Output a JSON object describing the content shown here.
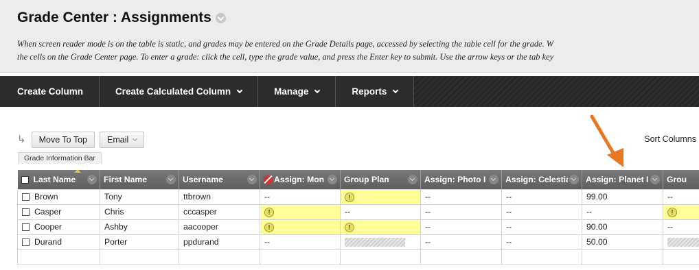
{
  "page": {
    "title": "Grade Center : Assignments",
    "instructions_line1": "When screen reader mode is on the table is static, and grades may be entered on the Grade Details page, accessed by selecting the table cell for the grade. W",
    "instructions_line2": "the cells on the Grade Center page. To enter a grade: click the cell, type the grade value, and press the Enter key to submit. Use the arrow keys or the tab key"
  },
  "toolbar": {
    "create_column": "Create Column",
    "create_calculated_column": "Create Calculated Column",
    "manage": "Manage",
    "reports": "Reports"
  },
  "actions": {
    "move_to_top": "Move To Top",
    "email": "Email",
    "sort_columns": "Sort Columns",
    "grade_info_bar": "Grade Information Bar"
  },
  "grid": {
    "headers": [
      "Last Name",
      "First Name",
      "Username",
      "Assign: Mon",
      "Group Plan",
      "Assign: Photo I",
      "Assign: Celestia",
      "Assign: Planet I",
      "Grou"
    ],
    "rows": [
      {
        "last": "Brown",
        "first": "Tony",
        "user": "ttbrown",
        "c4": "--",
        "c5": "needs",
        "c6": "--",
        "c7": "--",
        "c8": "99.00",
        "c9": "--"
      },
      {
        "last": "Casper",
        "first": "Chris",
        "user": "cccasper",
        "c4": "needs",
        "c5": "--",
        "c6": "--",
        "c7": "--",
        "c8": "--",
        "c9": "needs"
      },
      {
        "last": "Cooper",
        "first": "Ashby",
        "user": "aacooper",
        "c4": "needs",
        "c5": "needs",
        "c6": "--",
        "c7": "--",
        "c8": "90.00",
        "c9": "--"
      },
      {
        "last": "Durand",
        "first": "Porter",
        "user": "ppdurand",
        "c4": "--",
        "c5": "hatch",
        "c6": "--",
        "c7": "--",
        "c8": "50.00",
        "c9": "hatch"
      }
    ]
  },
  "colors": {
    "toolbar_bg": "#2a2a2a",
    "header_bg": "#ececec",
    "needs_grading_highlight": "#ffff99",
    "annotation_arrow": "#e87722"
  }
}
